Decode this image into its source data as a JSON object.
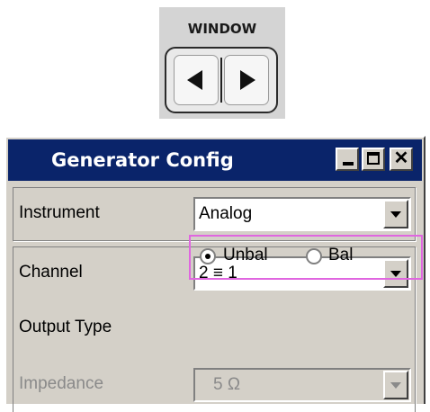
{
  "window_key": {
    "label": "WINDOW",
    "left_arrow_icon": "arrow-left-icon",
    "right_arrow_icon": "arrow-right-icon"
  },
  "generator_window": {
    "title": "Generator Config",
    "title_buttons": {
      "minimize": "minimize-icon",
      "maximize": "maximize-icon",
      "close": "close-icon",
      "close_glyph": "✕"
    },
    "instrument": {
      "label": "Instrument",
      "value": "Analog"
    },
    "channel": {
      "label": "Channel",
      "value": "2 ≡ 1"
    },
    "output_type": {
      "label": "Output Type",
      "options": [
        "Unbal",
        "Bal"
      ],
      "selected": "Unbal"
    },
    "impedance": {
      "label": "Impedance",
      "value": "5 Ω",
      "enabled": false
    }
  },
  "colors": {
    "titlebar": "#0a246a",
    "window_bg": "#d4d0c8",
    "highlight": "#e066e0"
  }
}
